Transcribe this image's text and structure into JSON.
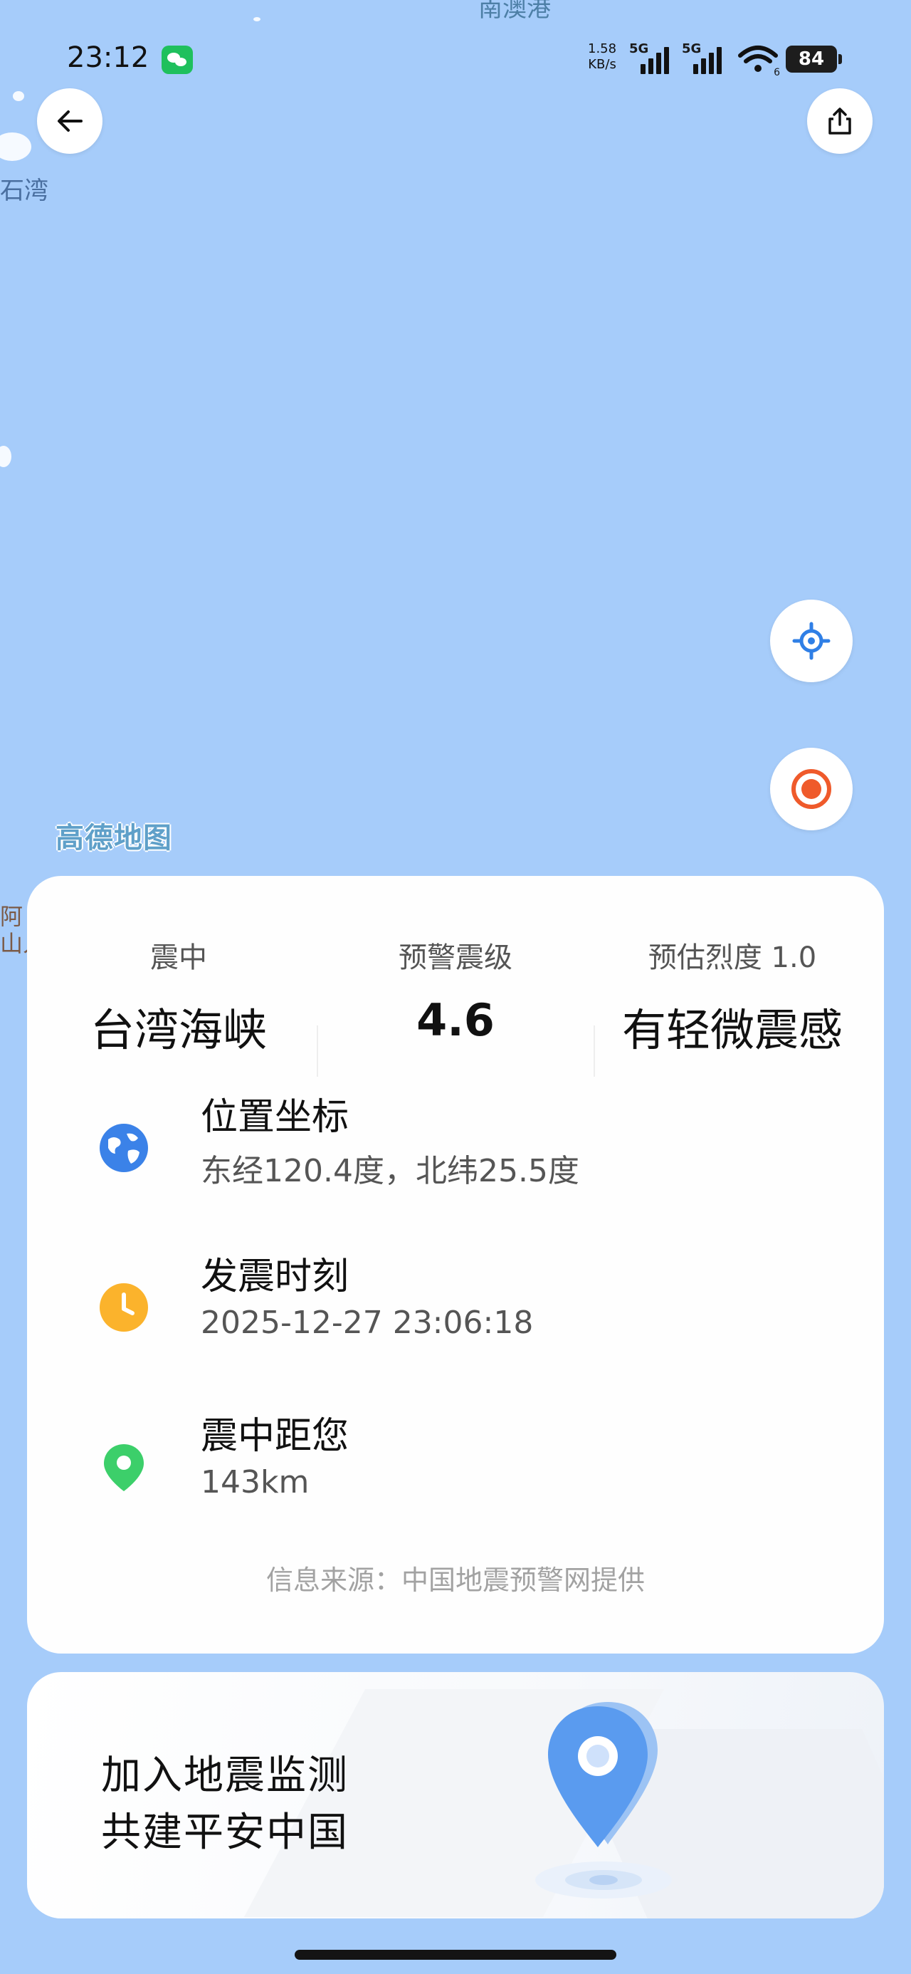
{
  "map": {
    "label_top": "南澳港",
    "label_left": "石湾",
    "label_left2": "阿\n山人",
    "watermark": "高德地图"
  },
  "status_bar": {
    "time": "23:12",
    "net_speed_value": "1.58",
    "net_speed_unit": "KB/s",
    "signal1_label": "5G",
    "signal2_label": "5G",
    "wifi_sub": "6",
    "battery": "84"
  },
  "summary": {
    "epicenter_label": "震中",
    "epicenter_value": "台湾海峡",
    "magnitude_label": "预警震级",
    "magnitude_value": "4.6",
    "intensity_label": "预估烈度 1.0",
    "intensity_value": "有轻微震感"
  },
  "details": {
    "location_title": "位置坐标",
    "location_value": "东经120.4度，北纬25.5度",
    "time_title": "发震时刻",
    "time_value": "2025-12-27 23:06:18",
    "distance_title": "震中距您",
    "distance_value": "143km"
  },
  "source": "信息来源：中国地震预警网提供",
  "banner": {
    "line1": "加入地震监测",
    "line2": "共建平安中国"
  },
  "colors": {
    "map_water": "#a6ccfa",
    "globe_blue": "#3b82e8",
    "clock_orange": "#fbb32c",
    "pin_green": "#3ccf6a",
    "quake_red": "#ef5a2b",
    "locate_blue": "#2f7fe6"
  },
  "icons": [
    "back-arrow-icon",
    "share-icon",
    "locate-icon",
    "quake-target-icon",
    "globe-icon",
    "clock-icon",
    "location-pin-icon",
    "wechat-icon",
    "wifi-icon"
  ]
}
